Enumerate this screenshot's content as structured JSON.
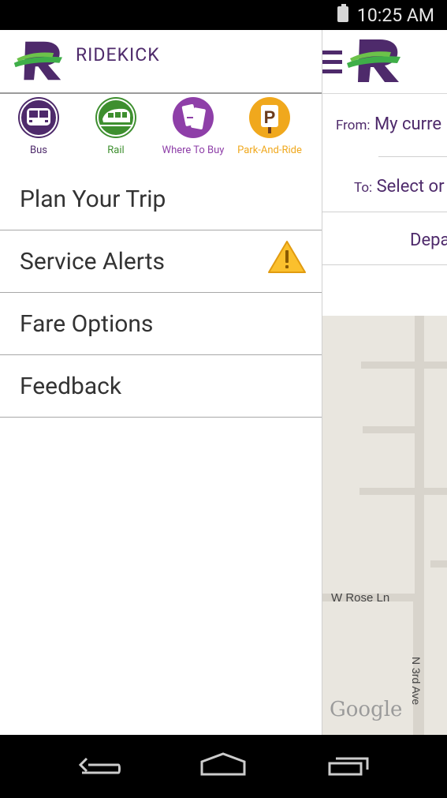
{
  "status": {
    "time": "10:25 AM"
  },
  "drawer": {
    "brand": "RIDEKICK",
    "modes": [
      {
        "label": "Bus",
        "color": "#4e2a6b"
      },
      {
        "label": "Rail",
        "color": "#3e8f2f"
      },
      {
        "label": "Where To Buy",
        "color": "#8e3fa8"
      },
      {
        "label": "Park-And-Ride",
        "color": "#f0a81d"
      }
    ],
    "menu": [
      {
        "label": "Plan Your Trip"
      },
      {
        "label": "Service Alerts"
      },
      {
        "label": "Fare Options"
      },
      {
        "label": "Feedback"
      }
    ]
  },
  "planner": {
    "from_label": "From:",
    "from_value": "My curre",
    "to_label": "To:",
    "to_value": "Select or",
    "depart": "Depa"
  },
  "map": {
    "street1": "W Rose Ln",
    "street2": "N 3rd Ave",
    "attribution": "Google"
  }
}
